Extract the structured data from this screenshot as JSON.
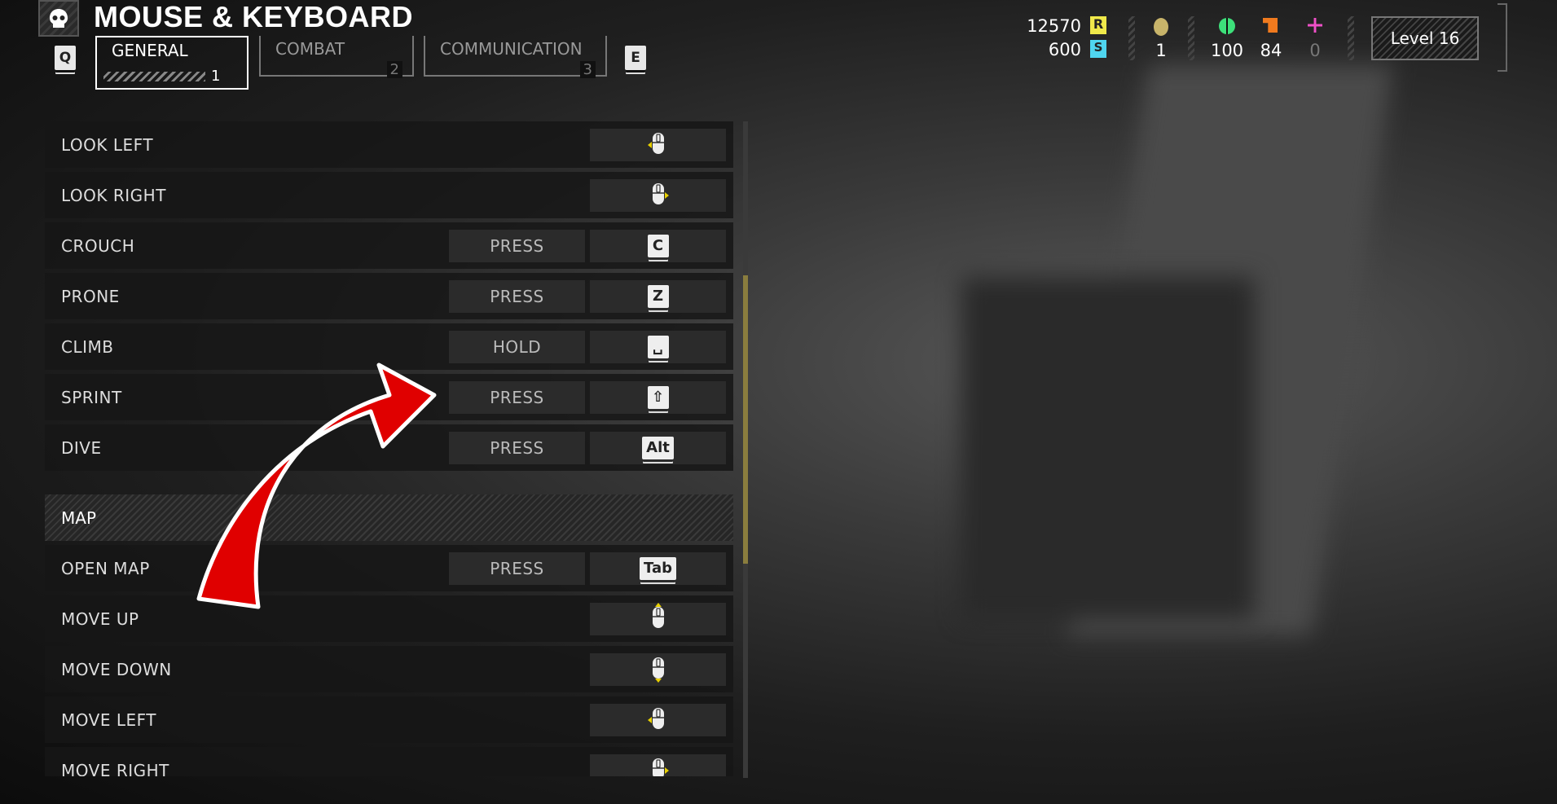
{
  "header": {
    "title": "MOUSE & KEYBOARD",
    "logo_icon": "skull-icon",
    "prev_key": "Q",
    "next_key": "E"
  },
  "tabs": [
    {
      "label": "GENERAL",
      "num": "1",
      "active": true
    },
    {
      "label": "COMBAT",
      "num": "2"
    },
    {
      "label": "COMMUNICATION",
      "num": "3"
    }
  ],
  "stats": {
    "requisition": "12570",
    "super_credits": "600",
    "medals": "1",
    "common_samples": "100",
    "rare_samples": "84",
    "super_samples": "0",
    "level": "Level 16",
    "colors": {
      "requisition": "#f0e94a",
      "super_credits": "#4fd6f0",
      "common": "#3de07a",
      "rare": "#f07a1e",
      "super": "#f050c8",
      "medal": "#c8b46a"
    }
  },
  "bindings": [
    {
      "action": "LOOK LEFT",
      "key": "mouse-left"
    },
    {
      "action": "LOOK RIGHT",
      "key": "mouse-right"
    },
    {
      "action": "CROUCH",
      "mode": "PRESS",
      "key": "C"
    },
    {
      "action": "PRONE",
      "mode": "PRESS",
      "key": "Z"
    },
    {
      "action": "CLIMB",
      "mode": "HOLD",
      "key": "␣"
    },
    {
      "action": "SPRINT",
      "mode": "PRESS",
      "key": "⇧"
    },
    {
      "action": "DIVE",
      "mode": "PRESS",
      "key": "Alt"
    }
  ],
  "map_section": {
    "title": "MAP",
    "bindings": [
      {
        "action": "OPEN MAP",
        "mode": "PRESS",
        "key": "Tab"
      },
      {
        "action": "MOVE UP",
        "key": "mouse-up"
      },
      {
        "action": "MOVE DOWN",
        "key": "mouse-down"
      },
      {
        "action": "MOVE LEFT",
        "key": "mouse-left"
      },
      {
        "action": "MOVE RIGHT",
        "key": "mouse-right"
      }
    ]
  },
  "annotation": {
    "type": "red-arrow",
    "color": "#e00000"
  },
  "scroll_position": 0.24
}
